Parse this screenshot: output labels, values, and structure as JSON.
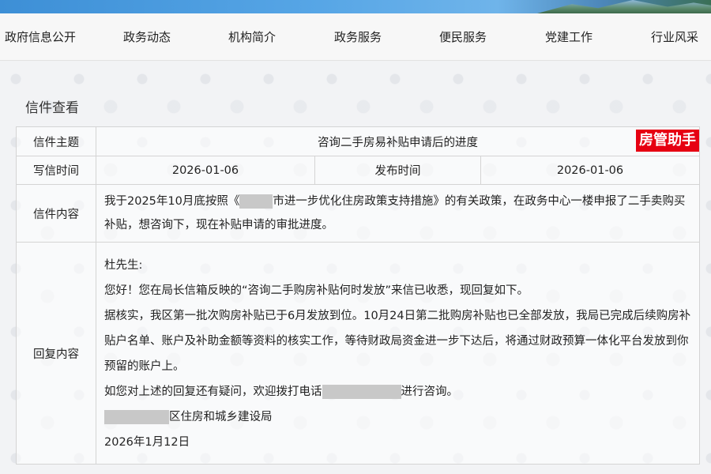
{
  "nav": {
    "items": [
      "政府信息公开",
      "政务动态",
      "机构简介",
      "政务服务",
      "便民服务",
      "党建工作",
      "行业风采"
    ]
  },
  "section_title": "信件查看",
  "letter": {
    "subject_label": "信件主题",
    "subject": "咨询二手房易补贴申请后的进度",
    "badge": "房管助手",
    "write_time_label": "写信时间",
    "write_time": "2026-01-06",
    "publish_time_label": "发布时间",
    "publish_time": "2026-01-06",
    "content_label": "信件内容",
    "content_part1": "我于2025年10月底按照《",
    "content_part2": "市进一步优化住房政策支持措施》的有关政策，在政务中心一楼申报了二手卖购买补贴，想咨询下，现在补贴申请的审批进度。",
    "reply_label": "回复内容",
    "reply": {
      "salutation": "杜先生:",
      "para1": " 您好！您在局长信箱反映的“咨询二手购房补贴何时发放”来信已收悉，现回复如下。",
      "para2": "据核实，我区第一批次购房补贴已于6月发放到位。10月24日第二批购房补贴也已全部发放，我局已完成后续购房补贴户名单、账户及补助金额等资料的核实工作，等待财政局资金进一步下达后，将通过财政预算一体化平台发放到你预留的账户上。",
      "para3_part1": "如您对上述的回复还有疑问，欢迎拨打电话",
      "para3_part2": "进行咨询。",
      "signature": "区住房和城乡建设局",
      "date": " 2026年1月12日"
    }
  },
  "colors": {
    "badge_bg": "#e60012",
    "redaction": "#c8c8c8"
  }
}
